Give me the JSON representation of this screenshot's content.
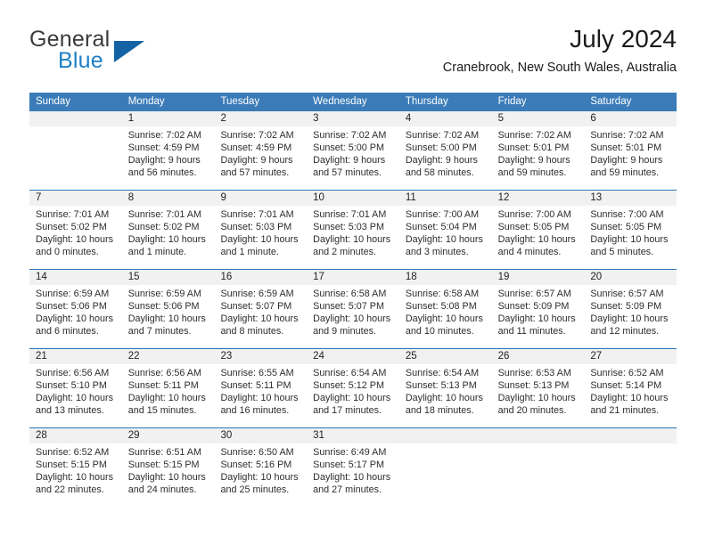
{
  "brand": {
    "name_part1": "General",
    "name_part2": "Blue",
    "colors": {
      "dark": "#3b3b3b",
      "blue": "#1f7fc4",
      "triangle": "#1464a5"
    }
  },
  "header": {
    "title": "July 2024",
    "subtitle": "Cranebrook, New South Wales, Australia"
  },
  "theme": {
    "header_blue": "#3b7cb8",
    "row_divider_blue": "#2e74b5",
    "daynum_band": "#f1f1f1"
  },
  "weekdays": [
    "Sunday",
    "Monday",
    "Tuesday",
    "Wednesday",
    "Thursday",
    "Friday",
    "Saturday"
  ],
  "weeks": [
    {
      "days": [
        {
          "num": "",
          "sunrise": "",
          "sunset": "",
          "daylight": ""
        },
        {
          "num": "1",
          "sunrise": "Sunrise: 7:02 AM",
          "sunset": "Sunset: 4:59 PM",
          "daylight": "Daylight: 9 hours and 56 minutes."
        },
        {
          "num": "2",
          "sunrise": "Sunrise: 7:02 AM",
          "sunset": "Sunset: 4:59 PM",
          "daylight": "Daylight: 9 hours and 57 minutes."
        },
        {
          "num": "3",
          "sunrise": "Sunrise: 7:02 AM",
          "sunset": "Sunset: 5:00 PM",
          "daylight": "Daylight: 9 hours and 57 minutes."
        },
        {
          "num": "4",
          "sunrise": "Sunrise: 7:02 AM",
          "sunset": "Sunset: 5:00 PM",
          "daylight": "Daylight: 9 hours and 58 minutes."
        },
        {
          "num": "5",
          "sunrise": "Sunrise: 7:02 AM",
          "sunset": "Sunset: 5:01 PM",
          "daylight": "Daylight: 9 hours and 59 minutes."
        },
        {
          "num": "6",
          "sunrise": "Sunrise: 7:02 AM",
          "sunset": "Sunset: 5:01 PM",
          "daylight": "Daylight: 9 hours and 59 minutes."
        }
      ]
    },
    {
      "days": [
        {
          "num": "7",
          "sunrise": "Sunrise: 7:01 AM",
          "sunset": "Sunset: 5:02 PM",
          "daylight": "Daylight: 10 hours and 0 minutes."
        },
        {
          "num": "8",
          "sunrise": "Sunrise: 7:01 AM",
          "sunset": "Sunset: 5:02 PM",
          "daylight": "Daylight: 10 hours and 1 minute."
        },
        {
          "num": "9",
          "sunrise": "Sunrise: 7:01 AM",
          "sunset": "Sunset: 5:03 PM",
          "daylight": "Daylight: 10 hours and 1 minute."
        },
        {
          "num": "10",
          "sunrise": "Sunrise: 7:01 AM",
          "sunset": "Sunset: 5:03 PM",
          "daylight": "Daylight: 10 hours and 2 minutes."
        },
        {
          "num": "11",
          "sunrise": "Sunrise: 7:00 AM",
          "sunset": "Sunset: 5:04 PM",
          "daylight": "Daylight: 10 hours and 3 minutes."
        },
        {
          "num": "12",
          "sunrise": "Sunrise: 7:00 AM",
          "sunset": "Sunset: 5:05 PM",
          "daylight": "Daylight: 10 hours and 4 minutes."
        },
        {
          "num": "13",
          "sunrise": "Sunrise: 7:00 AM",
          "sunset": "Sunset: 5:05 PM",
          "daylight": "Daylight: 10 hours and 5 minutes."
        }
      ]
    },
    {
      "days": [
        {
          "num": "14",
          "sunrise": "Sunrise: 6:59 AM",
          "sunset": "Sunset: 5:06 PM",
          "daylight": "Daylight: 10 hours and 6 minutes."
        },
        {
          "num": "15",
          "sunrise": "Sunrise: 6:59 AM",
          "sunset": "Sunset: 5:06 PM",
          "daylight": "Daylight: 10 hours and 7 minutes."
        },
        {
          "num": "16",
          "sunrise": "Sunrise: 6:59 AM",
          "sunset": "Sunset: 5:07 PM",
          "daylight": "Daylight: 10 hours and 8 minutes."
        },
        {
          "num": "17",
          "sunrise": "Sunrise: 6:58 AM",
          "sunset": "Sunset: 5:07 PM",
          "daylight": "Daylight: 10 hours and 9 minutes."
        },
        {
          "num": "18",
          "sunrise": "Sunrise: 6:58 AM",
          "sunset": "Sunset: 5:08 PM",
          "daylight": "Daylight: 10 hours and 10 minutes."
        },
        {
          "num": "19",
          "sunrise": "Sunrise: 6:57 AM",
          "sunset": "Sunset: 5:09 PM",
          "daylight": "Daylight: 10 hours and 11 minutes."
        },
        {
          "num": "20",
          "sunrise": "Sunrise: 6:57 AM",
          "sunset": "Sunset: 5:09 PM",
          "daylight": "Daylight: 10 hours and 12 minutes."
        }
      ]
    },
    {
      "days": [
        {
          "num": "21",
          "sunrise": "Sunrise: 6:56 AM",
          "sunset": "Sunset: 5:10 PM",
          "daylight": "Daylight: 10 hours and 13 minutes."
        },
        {
          "num": "22",
          "sunrise": "Sunrise: 6:56 AM",
          "sunset": "Sunset: 5:11 PM",
          "daylight": "Daylight: 10 hours and 15 minutes."
        },
        {
          "num": "23",
          "sunrise": "Sunrise: 6:55 AM",
          "sunset": "Sunset: 5:11 PM",
          "daylight": "Daylight: 10 hours and 16 minutes."
        },
        {
          "num": "24",
          "sunrise": "Sunrise: 6:54 AM",
          "sunset": "Sunset: 5:12 PM",
          "daylight": "Daylight: 10 hours and 17 minutes."
        },
        {
          "num": "25",
          "sunrise": "Sunrise: 6:54 AM",
          "sunset": "Sunset: 5:13 PM",
          "daylight": "Daylight: 10 hours and 18 minutes."
        },
        {
          "num": "26",
          "sunrise": "Sunrise: 6:53 AM",
          "sunset": "Sunset: 5:13 PM",
          "daylight": "Daylight: 10 hours and 20 minutes."
        },
        {
          "num": "27",
          "sunrise": "Sunrise: 6:52 AM",
          "sunset": "Sunset: 5:14 PM",
          "daylight": "Daylight: 10 hours and 21 minutes."
        }
      ]
    },
    {
      "days": [
        {
          "num": "28",
          "sunrise": "Sunrise: 6:52 AM",
          "sunset": "Sunset: 5:15 PM",
          "daylight": "Daylight: 10 hours and 22 minutes."
        },
        {
          "num": "29",
          "sunrise": "Sunrise: 6:51 AM",
          "sunset": "Sunset: 5:15 PM",
          "daylight": "Daylight: 10 hours and 24 minutes."
        },
        {
          "num": "30",
          "sunrise": "Sunrise: 6:50 AM",
          "sunset": "Sunset: 5:16 PM",
          "daylight": "Daylight: 10 hours and 25 minutes."
        },
        {
          "num": "31",
          "sunrise": "Sunrise: 6:49 AM",
          "sunset": "Sunset: 5:17 PM",
          "daylight": "Daylight: 10 hours and 27 minutes."
        },
        {
          "num": "",
          "sunrise": "",
          "sunset": "",
          "daylight": ""
        },
        {
          "num": "",
          "sunrise": "",
          "sunset": "",
          "daylight": ""
        },
        {
          "num": "",
          "sunrise": "",
          "sunset": "",
          "daylight": ""
        }
      ]
    }
  ]
}
